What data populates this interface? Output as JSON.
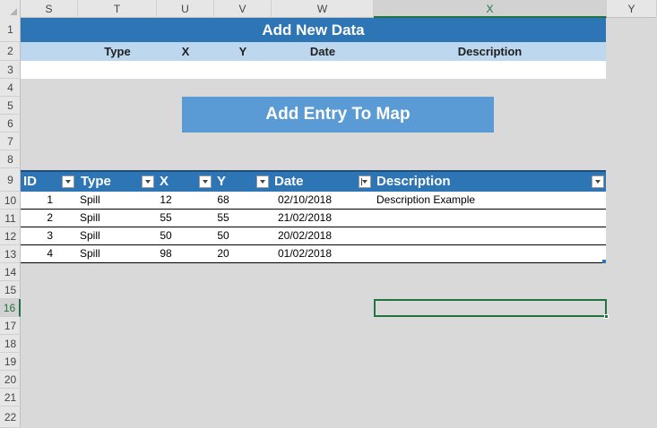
{
  "columns": [
    "S",
    "T",
    "U",
    "V",
    "W",
    "X",
    "Y"
  ],
  "selected_column": "X",
  "rows": [
    "1",
    "2",
    "3",
    "4",
    "5",
    "6",
    "7",
    "8",
    "9",
    "10",
    "11",
    "12",
    "13",
    "14",
    "15",
    "16",
    "17",
    "18",
    "19",
    "20",
    "21",
    "22"
  ],
  "selected_row": "16",
  "form": {
    "title": "Add New Data",
    "headers": [
      "Type",
      "X",
      "Y",
      "Date",
      "Description"
    ]
  },
  "button": {
    "label": "Add Entry To Map"
  },
  "table": {
    "headers": [
      "ID",
      "Type",
      "X",
      "Y",
      "Date",
      "Description"
    ],
    "sorted_column": "Date",
    "rows": [
      [
        "1",
        "Spill",
        "12",
        "68",
        "02/10/2018",
        "Description Example"
      ],
      [
        "2",
        "Spill",
        "55",
        "55",
        "21/02/2018",
        ""
      ],
      [
        "3",
        "Spill",
        "50",
        "50",
        "20/02/2018",
        ""
      ],
      [
        "4",
        "Spill",
        "98",
        "20",
        "01/02/2018",
        ""
      ]
    ]
  },
  "colors": {
    "header_blue": "#2e75b6",
    "light_blue": "#bdd7ee",
    "button_blue": "#5b9bd5",
    "selection_green": "#217346"
  }
}
